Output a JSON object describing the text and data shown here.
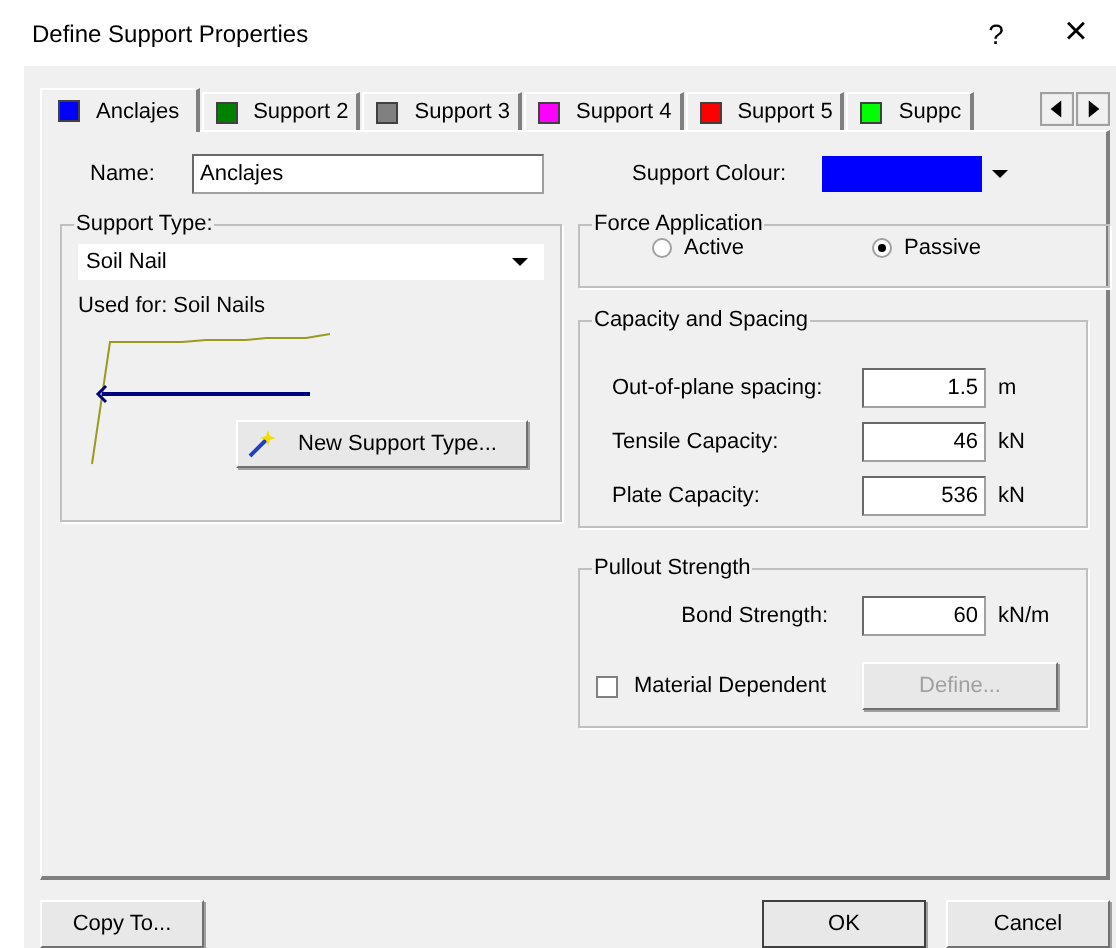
{
  "window": {
    "title": "Define Support Properties",
    "help": "?",
    "close": "×"
  },
  "tabs": [
    {
      "label": "Anclajes",
      "color": "#0000ff",
      "selected": true
    },
    {
      "label": "Support 2",
      "color": "#008000",
      "selected": false
    },
    {
      "label": "Support 3",
      "color": "#808080",
      "selected": false
    },
    {
      "label": "Support 4",
      "color": "#ff00ff",
      "selected": false
    },
    {
      "label": "Support 5",
      "color": "#ff0000",
      "selected": false
    },
    {
      "label": "Suppc",
      "color": "#00ff00",
      "selected": false
    }
  ],
  "name": {
    "label": "Name:",
    "value": "Anclajes"
  },
  "support_colour": {
    "label": "Support Colour:",
    "color": "#0000ff"
  },
  "support_type": {
    "legend": "Support Type:",
    "value": "Soil Nail",
    "used_for": "Used for: Soil Nails",
    "new_button": "New Support Type..."
  },
  "force_application": {
    "legend": "Force Application",
    "options": [
      {
        "label": "Active",
        "selected": false
      },
      {
        "label": "Passive",
        "selected": true
      }
    ]
  },
  "capacity": {
    "legend": "Capacity and Spacing",
    "rows": [
      {
        "label": "Out-of-plane spacing:",
        "value": "1.5",
        "unit": "m"
      },
      {
        "label": "Tensile Capacity:",
        "value": "46",
        "unit": "kN"
      },
      {
        "label": "Plate Capacity:",
        "value": "536",
        "unit": "kN"
      }
    ]
  },
  "pullout": {
    "legend": "Pullout Strength",
    "label": "Bond Strength:",
    "value": "60",
    "unit": "kN/m",
    "material": {
      "label": "Material Dependent",
      "checked": false
    },
    "define": {
      "label": "Define...",
      "disabled": true
    }
  },
  "buttons": {
    "copy": "Copy To...",
    "ok": "OK",
    "cancel": "Cancel"
  }
}
